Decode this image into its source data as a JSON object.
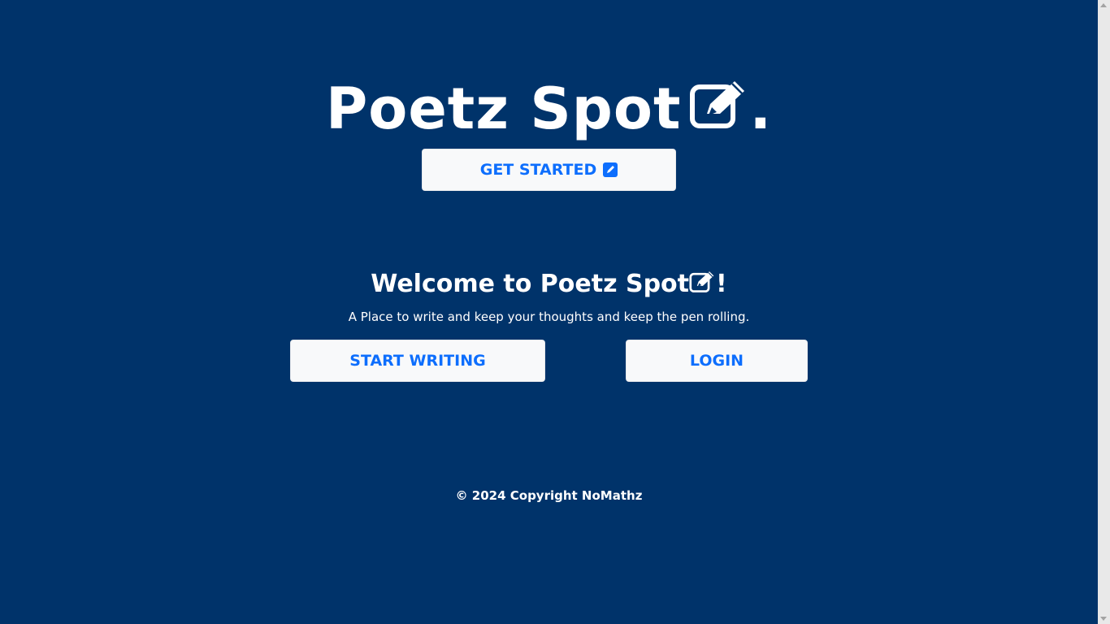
{
  "hero": {
    "title": "Poetz Spot",
    "icon": "pen-to-square-icon",
    "suffix": "."
  },
  "buttons": {
    "get_started": "GET STARTED",
    "start_writing": "START WRITING",
    "login": "LOGIN"
  },
  "welcome": {
    "prefix": "Welcome to Poetz Spot",
    "suffix": "!",
    "tagline": "A Place to write and keep your thoughts and keep the pen rolling."
  },
  "footer": {
    "copyright": "© 2024 Copyright NoMathz"
  },
  "colors": {
    "background": "#00336a",
    "button_bg": "#f8f9fa",
    "button_text": "#0d6efd",
    "text": "#ffffff"
  }
}
